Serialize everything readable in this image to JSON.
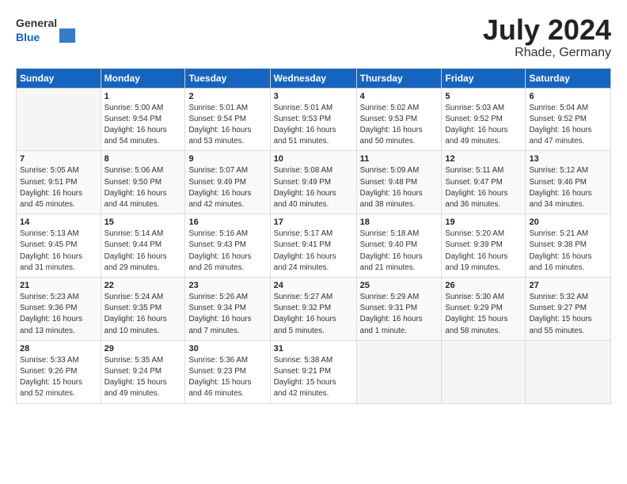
{
  "header": {
    "logo_general": "General",
    "logo_blue": "Blue",
    "month": "July 2024",
    "location": "Rhade, Germany"
  },
  "weekdays": [
    "Sunday",
    "Monday",
    "Tuesday",
    "Wednesday",
    "Thursday",
    "Friday",
    "Saturday"
  ],
  "weeks": [
    [
      {
        "num": "",
        "info": ""
      },
      {
        "num": "1",
        "info": "Sunrise: 5:00 AM\nSunset: 9:54 PM\nDaylight: 16 hours\nand 54 minutes."
      },
      {
        "num": "2",
        "info": "Sunrise: 5:01 AM\nSunset: 9:54 PM\nDaylight: 16 hours\nand 53 minutes."
      },
      {
        "num": "3",
        "info": "Sunrise: 5:01 AM\nSunset: 9:53 PM\nDaylight: 16 hours\nand 51 minutes."
      },
      {
        "num": "4",
        "info": "Sunrise: 5:02 AM\nSunset: 9:53 PM\nDaylight: 16 hours\nand 50 minutes."
      },
      {
        "num": "5",
        "info": "Sunrise: 5:03 AM\nSunset: 9:52 PM\nDaylight: 16 hours\nand 49 minutes."
      },
      {
        "num": "6",
        "info": "Sunrise: 5:04 AM\nSunset: 9:52 PM\nDaylight: 16 hours\nand 47 minutes."
      }
    ],
    [
      {
        "num": "7",
        "info": "Sunrise: 5:05 AM\nSunset: 9:51 PM\nDaylight: 16 hours\nand 45 minutes."
      },
      {
        "num": "8",
        "info": "Sunrise: 5:06 AM\nSunset: 9:50 PM\nDaylight: 16 hours\nand 44 minutes."
      },
      {
        "num": "9",
        "info": "Sunrise: 5:07 AM\nSunset: 9:49 PM\nDaylight: 16 hours\nand 42 minutes."
      },
      {
        "num": "10",
        "info": "Sunrise: 5:08 AM\nSunset: 9:49 PM\nDaylight: 16 hours\nand 40 minutes."
      },
      {
        "num": "11",
        "info": "Sunrise: 5:09 AM\nSunset: 9:48 PM\nDaylight: 16 hours\nand 38 minutes."
      },
      {
        "num": "12",
        "info": "Sunrise: 5:11 AM\nSunset: 9:47 PM\nDaylight: 16 hours\nand 36 minutes."
      },
      {
        "num": "13",
        "info": "Sunrise: 5:12 AM\nSunset: 9:46 PM\nDaylight: 16 hours\nand 34 minutes."
      }
    ],
    [
      {
        "num": "14",
        "info": "Sunrise: 5:13 AM\nSunset: 9:45 PM\nDaylight: 16 hours\nand 31 minutes."
      },
      {
        "num": "15",
        "info": "Sunrise: 5:14 AM\nSunset: 9:44 PM\nDaylight: 16 hours\nand 29 minutes."
      },
      {
        "num": "16",
        "info": "Sunrise: 5:16 AM\nSunset: 9:43 PM\nDaylight: 16 hours\nand 26 minutes."
      },
      {
        "num": "17",
        "info": "Sunrise: 5:17 AM\nSunset: 9:41 PM\nDaylight: 16 hours\nand 24 minutes."
      },
      {
        "num": "18",
        "info": "Sunrise: 5:18 AM\nSunset: 9:40 PM\nDaylight: 16 hours\nand 21 minutes."
      },
      {
        "num": "19",
        "info": "Sunrise: 5:20 AM\nSunset: 9:39 PM\nDaylight: 16 hours\nand 19 minutes."
      },
      {
        "num": "20",
        "info": "Sunrise: 5:21 AM\nSunset: 9:38 PM\nDaylight: 16 hours\nand 16 minutes."
      }
    ],
    [
      {
        "num": "21",
        "info": "Sunrise: 5:23 AM\nSunset: 9:36 PM\nDaylight: 16 hours\nand 13 minutes."
      },
      {
        "num": "22",
        "info": "Sunrise: 5:24 AM\nSunset: 9:35 PM\nDaylight: 16 hours\nand 10 minutes."
      },
      {
        "num": "23",
        "info": "Sunrise: 5:26 AM\nSunset: 9:34 PM\nDaylight: 16 hours\nand 7 minutes."
      },
      {
        "num": "24",
        "info": "Sunrise: 5:27 AM\nSunset: 9:32 PM\nDaylight: 16 hours\nand 5 minutes."
      },
      {
        "num": "25",
        "info": "Sunrise: 5:29 AM\nSunset: 9:31 PM\nDaylight: 16 hours\nand 1 minute."
      },
      {
        "num": "26",
        "info": "Sunrise: 5:30 AM\nSunset: 9:29 PM\nDaylight: 15 hours\nand 58 minutes."
      },
      {
        "num": "27",
        "info": "Sunrise: 5:32 AM\nSunset: 9:27 PM\nDaylight: 15 hours\nand 55 minutes."
      }
    ],
    [
      {
        "num": "28",
        "info": "Sunrise: 5:33 AM\nSunset: 9:26 PM\nDaylight: 15 hours\nand 52 minutes."
      },
      {
        "num": "29",
        "info": "Sunrise: 5:35 AM\nSunset: 9:24 PM\nDaylight: 15 hours\nand 49 minutes."
      },
      {
        "num": "30",
        "info": "Sunrise: 5:36 AM\nSunset: 9:23 PM\nDaylight: 15 hours\nand 46 minutes."
      },
      {
        "num": "31",
        "info": "Sunrise: 5:38 AM\nSunset: 9:21 PM\nDaylight: 15 hours\nand 42 minutes."
      },
      {
        "num": "",
        "info": ""
      },
      {
        "num": "",
        "info": ""
      },
      {
        "num": "",
        "info": ""
      }
    ]
  ]
}
